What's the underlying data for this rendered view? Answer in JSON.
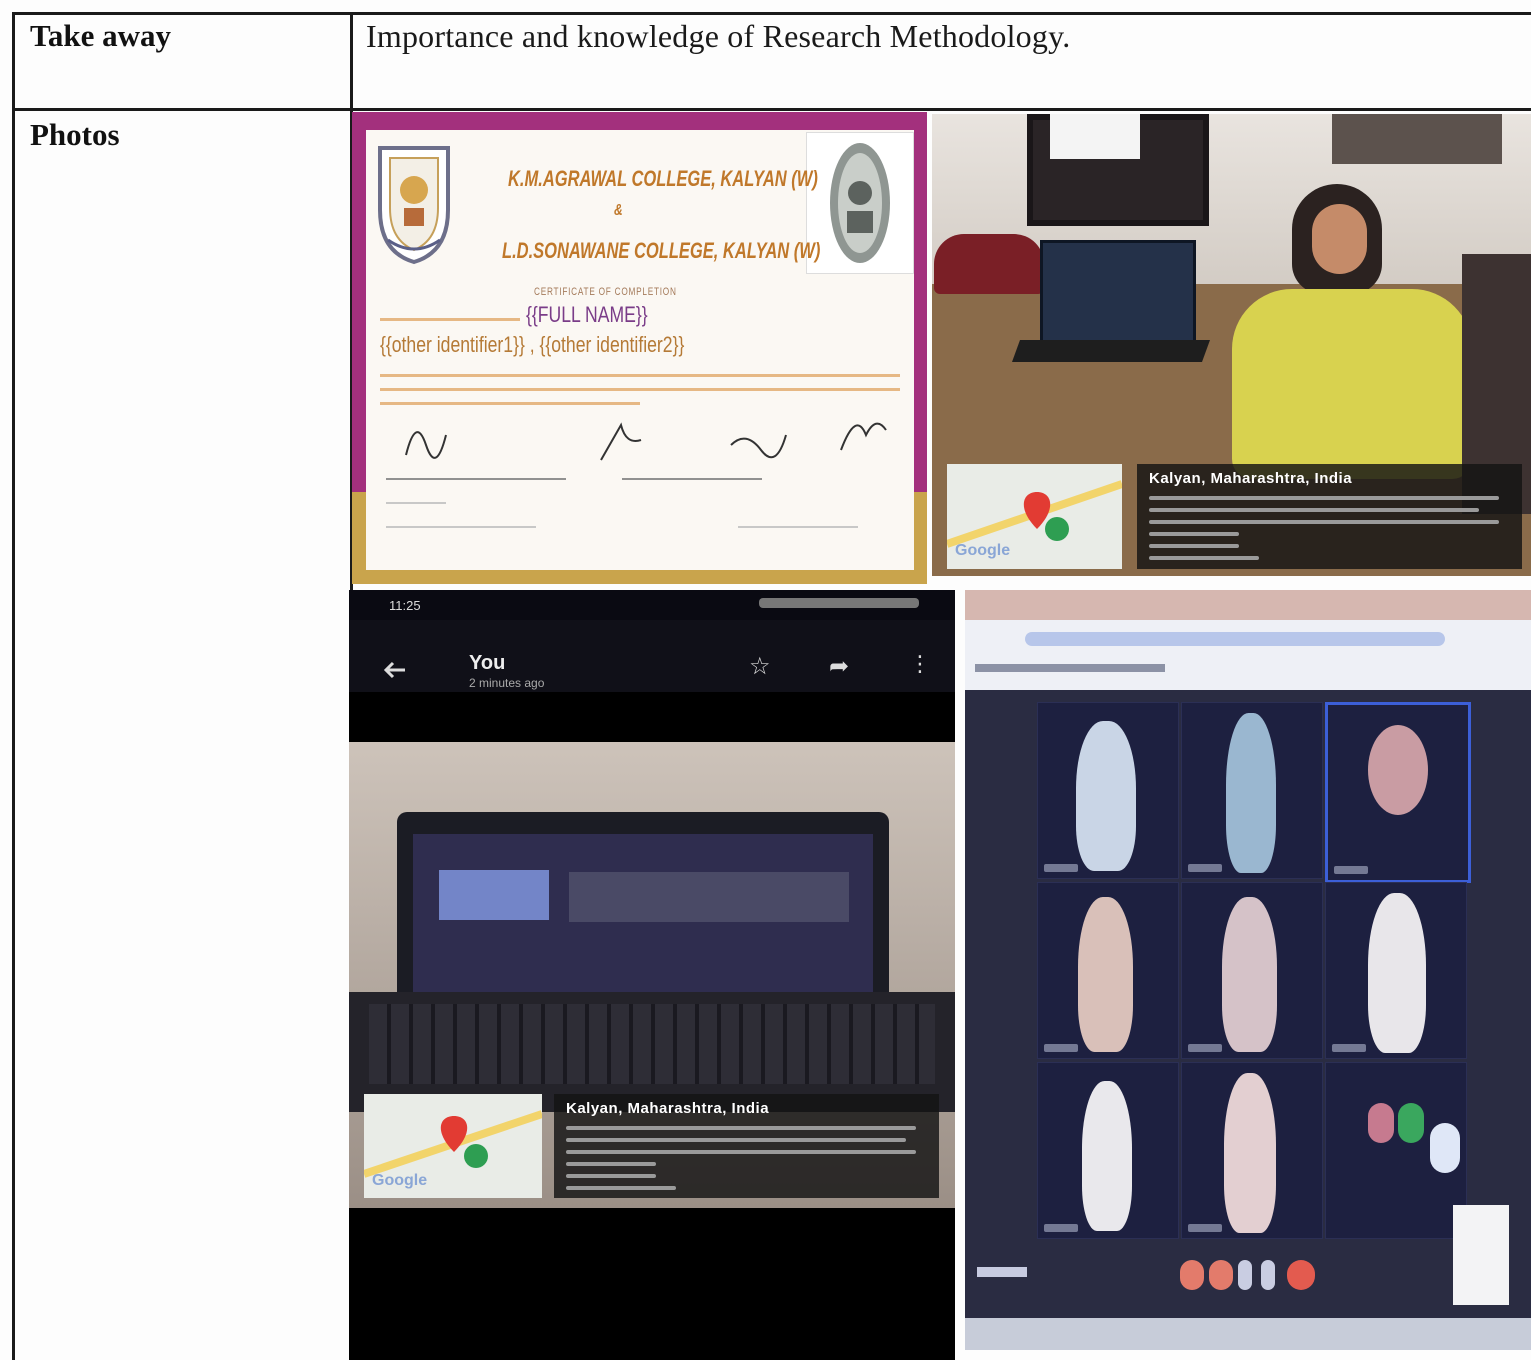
{
  "rows": [
    {
      "label": "Take away",
      "value": "Importance and knowledge of  Research Methodology."
    },
    {
      "label": "Photos",
      "value": ""
    }
  ],
  "certificate": {
    "college_line_1": "K.M.AGRAWAL COLLEGE, KALYAN (W)",
    "connector": "&",
    "college_line_2": "L.D.SONAWANE COLLEGE, KALYAN (W)",
    "heading": "CERTIFICATE OF COMPLETION",
    "name_field": "{{FULL NAME}}",
    "identifier_field": "{{other identifier1}} , {{other identifier2}}"
  },
  "geotag": {
    "location_title": "Kalyan, Maharashtra, India",
    "map_brand": "Google"
  },
  "phone": {
    "time": "11:25",
    "title": "You",
    "subtitle": "2 minutes ago"
  },
  "colors": {
    "certificate_border": "#a3307d",
    "certificate_gold": "#c9a44c",
    "call_background": "#2a2c42"
  }
}
